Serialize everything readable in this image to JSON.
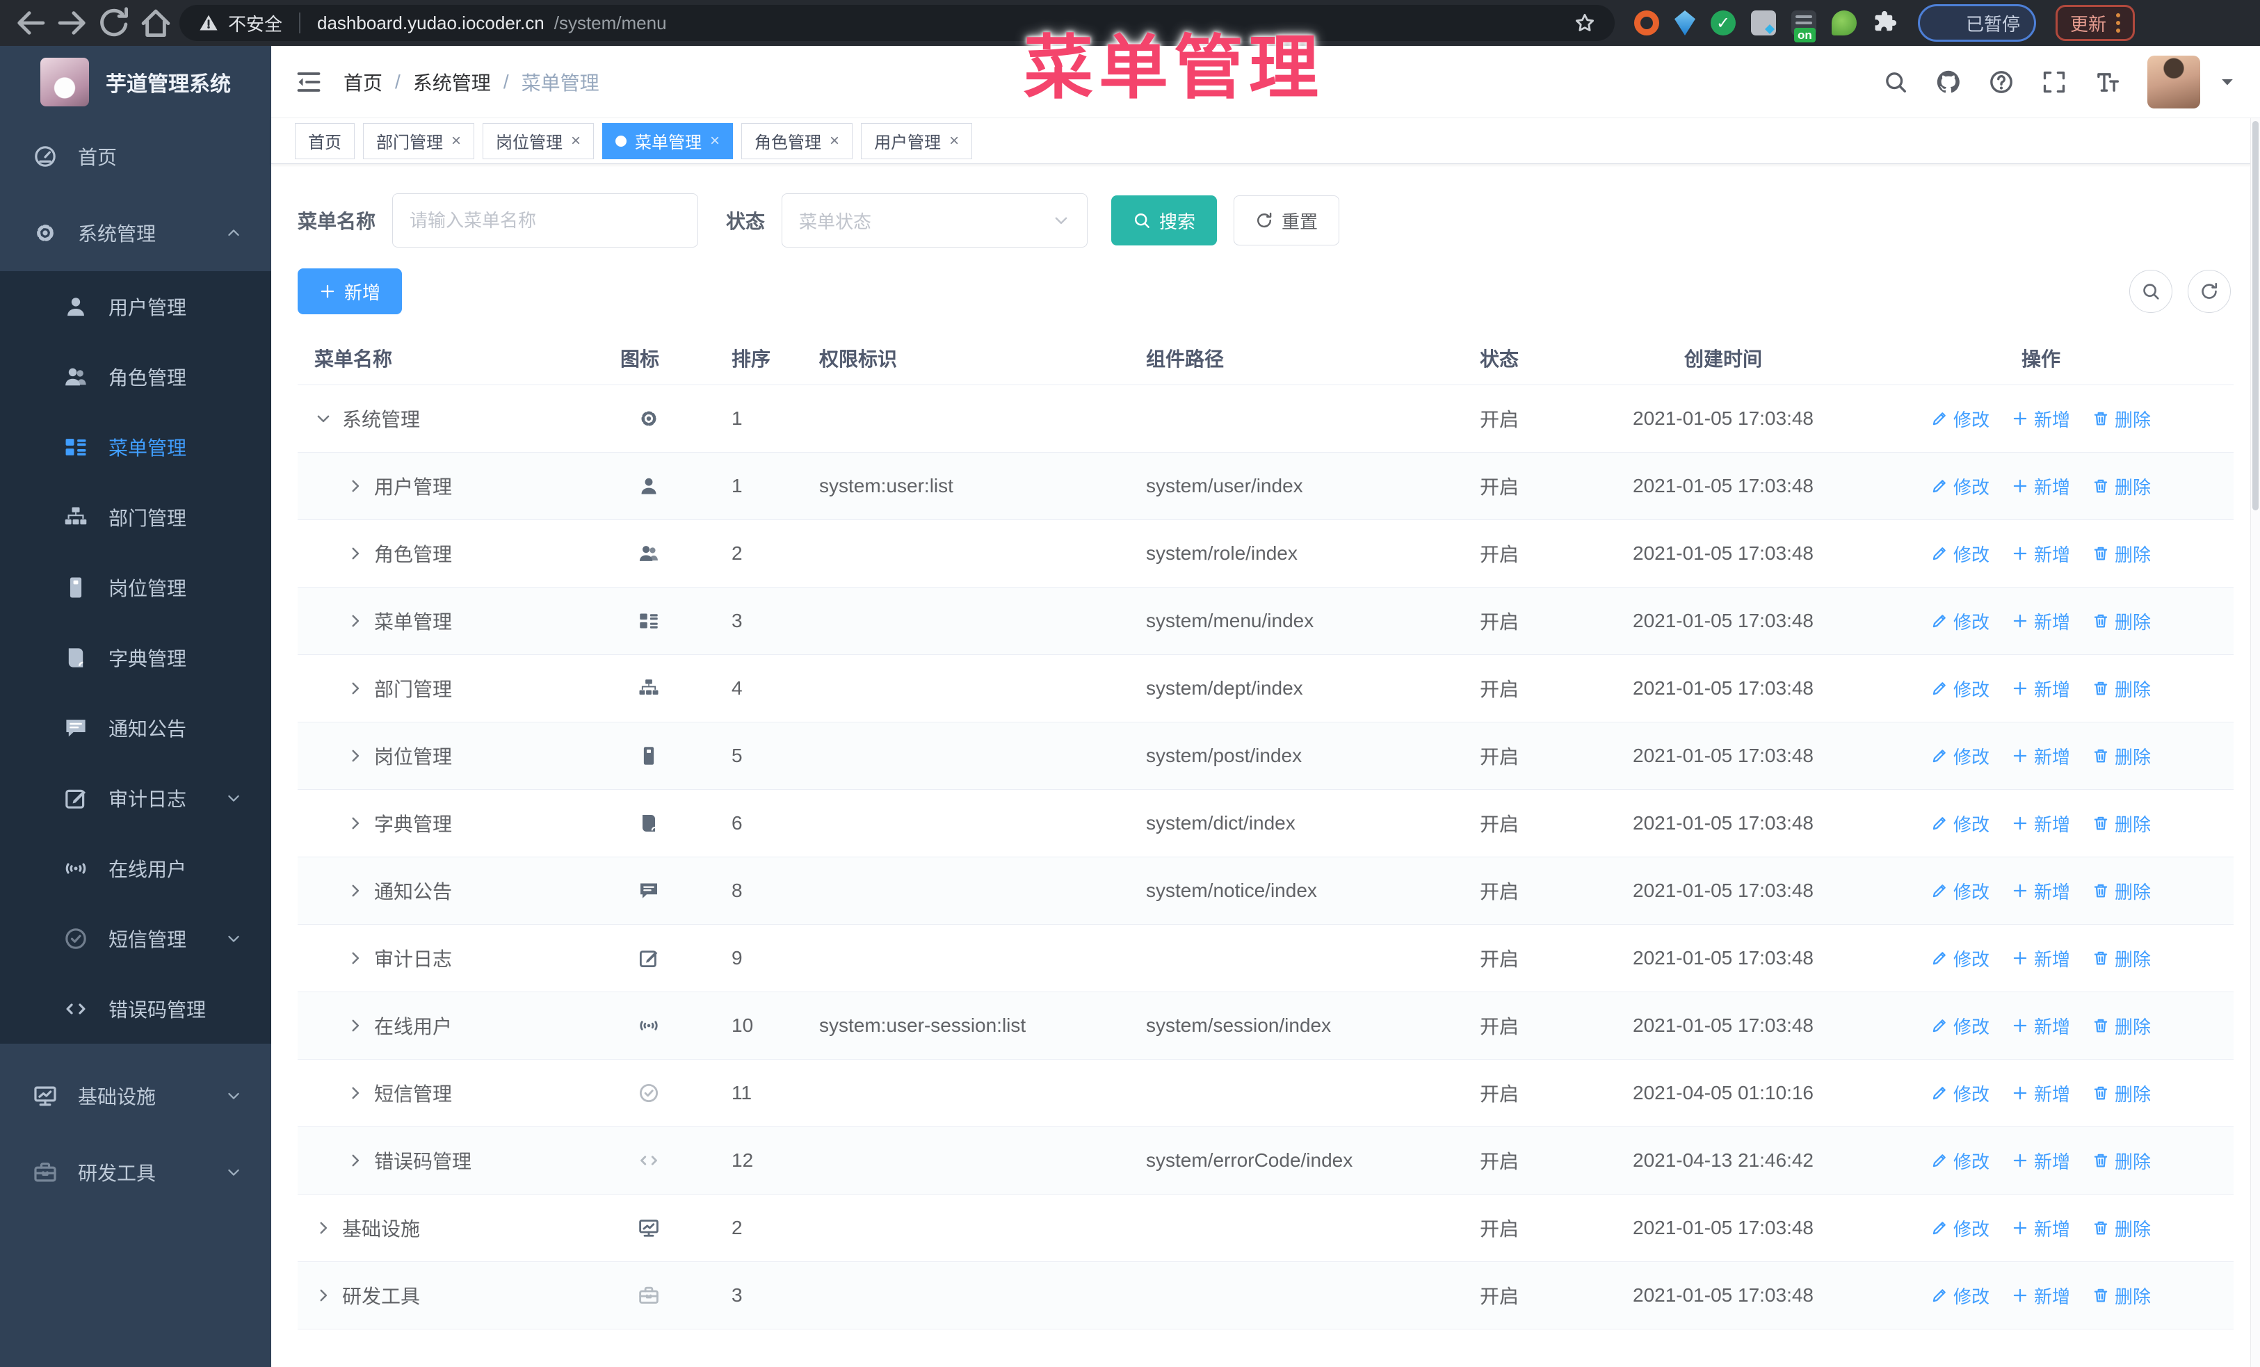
{
  "browser": {
    "security_label": "不安全",
    "url_host": "dashboard.yudao.iocoder.cn",
    "url_path": "/system/menu",
    "paused_label": "已暂停",
    "update_label": "更新",
    "extensions_on_badge": "on"
  },
  "annotation": "菜单管理",
  "sidebar": {
    "title": "芋道管理系统",
    "items": [
      {
        "label": "首页",
        "icon": "dashboard",
        "level": 0
      },
      {
        "label": "系统管理",
        "icon": "gear",
        "level": 0,
        "chevron": "up"
      },
      {
        "label": "用户管理",
        "icon": "user",
        "level": 1
      },
      {
        "label": "角色管理",
        "icon": "users",
        "level": 1
      },
      {
        "label": "菜单管理",
        "icon": "menu-tree",
        "level": 1,
        "active": true
      },
      {
        "label": "部门管理",
        "icon": "org-tree",
        "level": 1
      },
      {
        "label": "岗位管理",
        "icon": "badge",
        "level": 1
      },
      {
        "label": "字典管理",
        "icon": "book",
        "level": 1
      },
      {
        "label": "通知公告",
        "icon": "message",
        "level": 1
      },
      {
        "label": "审计日志",
        "icon": "edit-square",
        "level": 1,
        "chevron": "down"
      },
      {
        "label": "在线用户",
        "icon": "online",
        "level": 1
      },
      {
        "label": "短信管理",
        "icon": "shield-check",
        "level": 1,
        "chevron": "down",
        "light": true
      },
      {
        "label": "错误码管理",
        "icon": "code",
        "level": 1
      },
      {
        "label": "基础设施",
        "icon": "monitor",
        "level": 0,
        "chevron": "down",
        "gap": true
      },
      {
        "label": "研发工具",
        "icon": "toolbox",
        "level": 0,
        "chevron": "down",
        "light": true
      }
    ]
  },
  "breadcrumb": {
    "items": [
      "首页",
      "系统管理",
      "菜单管理"
    ],
    "separator": "/"
  },
  "tabs": [
    {
      "label": "首页",
      "closable": false,
      "active": false
    },
    {
      "label": "部门管理",
      "closable": true,
      "active": false
    },
    {
      "label": "岗位管理",
      "closable": true,
      "active": false
    },
    {
      "label": "菜单管理",
      "closable": true,
      "active": true
    },
    {
      "label": "角色管理",
      "closable": true,
      "active": false
    },
    {
      "label": "用户管理",
      "closable": true,
      "active": false
    }
  ],
  "filters": {
    "name_label": "菜单名称",
    "name_placeholder": "请输入菜单名称",
    "status_label": "状态",
    "status_placeholder": "菜单状态",
    "search_label": "搜索",
    "reset_label": "重置"
  },
  "toolbar": {
    "add_label": "新增"
  },
  "table": {
    "columns": [
      "菜单名称",
      "图标",
      "排序",
      "权限标识",
      "组件路径",
      "状态",
      "创建时间",
      "操作"
    ],
    "row_actions": [
      "修改",
      "新增",
      "删除"
    ],
    "rows": [
      {
        "name": "系统管理",
        "icon": "gear",
        "level": 0,
        "expanded": true,
        "sort": "1",
        "perm": "",
        "path": "",
        "status": "开启",
        "time": "2021-01-05 17:03:48"
      },
      {
        "name": "用户管理",
        "icon": "user",
        "level": 1,
        "sort": "1",
        "perm": "system:user:list",
        "path": "system/user/index",
        "status": "开启",
        "time": "2021-01-05 17:03:48"
      },
      {
        "name": "角色管理",
        "icon": "users",
        "level": 1,
        "sort": "2",
        "perm": "",
        "path": "system/role/index",
        "status": "开启",
        "time": "2021-01-05 17:03:48"
      },
      {
        "name": "菜单管理",
        "icon": "menu-tree",
        "level": 1,
        "sort": "3",
        "perm": "",
        "path": "system/menu/index",
        "status": "开启",
        "time": "2021-01-05 17:03:48"
      },
      {
        "name": "部门管理",
        "icon": "org-tree",
        "level": 1,
        "sort": "4",
        "perm": "",
        "path": "system/dept/index",
        "status": "开启",
        "time": "2021-01-05 17:03:48"
      },
      {
        "name": "岗位管理",
        "icon": "badge",
        "level": 1,
        "sort": "5",
        "perm": "",
        "path": "system/post/index",
        "status": "开启",
        "time": "2021-01-05 17:03:48"
      },
      {
        "name": "字典管理",
        "icon": "book",
        "level": 1,
        "sort": "6",
        "perm": "",
        "path": "system/dict/index",
        "status": "开启",
        "time": "2021-01-05 17:03:48"
      },
      {
        "name": "通知公告",
        "icon": "message",
        "level": 1,
        "sort": "8",
        "perm": "",
        "path": "system/notice/index",
        "status": "开启",
        "time": "2021-01-05 17:03:48"
      },
      {
        "name": "审计日志",
        "icon": "edit-square",
        "level": 1,
        "sort": "9",
        "perm": "",
        "path": "",
        "status": "开启",
        "time": "2021-01-05 17:03:48"
      },
      {
        "name": "在线用户",
        "icon": "online",
        "level": 1,
        "sort": "10",
        "perm": "system:user-session:list",
        "path": "system/session/index",
        "status": "开启",
        "time": "2021-01-05 17:03:48"
      },
      {
        "name": "短信管理",
        "icon": "shield-check",
        "level": 1,
        "light": true,
        "sort": "11",
        "perm": "",
        "path": "",
        "status": "开启",
        "time": "2021-04-05 01:10:16"
      },
      {
        "name": "错误码管理",
        "icon": "code",
        "level": 1,
        "light": true,
        "sort": "12",
        "perm": "",
        "path": "system/errorCode/index",
        "status": "开启",
        "time": "2021-04-13 21:46:42"
      },
      {
        "name": "基础设施",
        "icon": "monitor",
        "level": 0,
        "sort": "2",
        "perm": "",
        "path": "",
        "status": "开启",
        "time": "2021-01-05 17:03:48"
      },
      {
        "name": "研发工具",
        "icon": "toolbox",
        "level": 0,
        "light": true,
        "sort": "3",
        "perm": "",
        "path": "",
        "status": "开启",
        "time": "2021-01-05 17:03:48"
      }
    ]
  },
  "colors": {
    "accent": "#409eff",
    "search_button": "#2ab7a9",
    "annotation": "#f4446c",
    "sidebar_bg": "#304156",
    "submenu_bg": "#1f2d3d"
  }
}
